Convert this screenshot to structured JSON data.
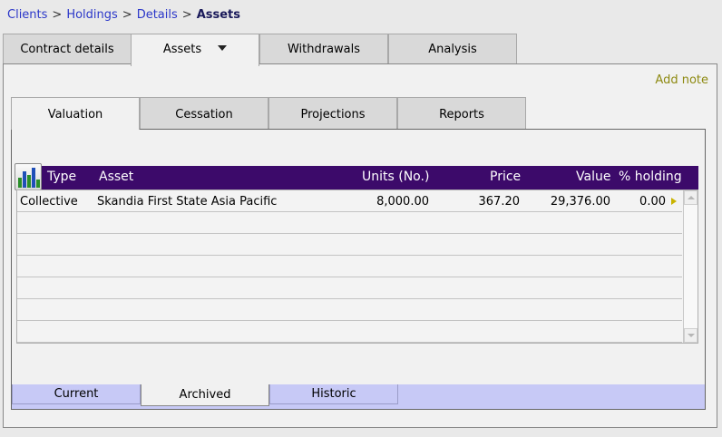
{
  "breadcrumb": {
    "items": [
      "Clients",
      "Holdings",
      "Details"
    ],
    "current": "Assets",
    "separator": ">"
  },
  "main_tabs": [
    {
      "label": "Contract details"
    },
    {
      "label": "Assets"
    },
    {
      "label": "Withdrawals"
    },
    {
      "label": "Analysis"
    }
  ],
  "add_note": "Add note",
  "sub_tabs": [
    {
      "label": "Valuation"
    },
    {
      "label": "Cessation"
    },
    {
      "label": "Projections"
    },
    {
      "label": "Reports"
    }
  ],
  "grid": {
    "columns": [
      "Type",
      "Asset",
      "Units (No.)",
      "Price",
      "Value",
      "% holding"
    ],
    "rows": [
      {
        "type": "Collective",
        "asset": "Skandia First State Asia Pacific",
        "units": "8,000.00",
        "price": "367.20",
        "value": "29,376.00",
        "holding": "0.00"
      }
    ]
  },
  "bottom_tabs": [
    {
      "label": "Current"
    },
    {
      "label": "Archived"
    },
    {
      "label": "Historic"
    }
  ],
  "colors": {
    "header_bg": "#3c0a6a",
    "link": "#2b37c9",
    "add_note": "#8e8a12",
    "bottom_bar": "#c7c9f6"
  }
}
